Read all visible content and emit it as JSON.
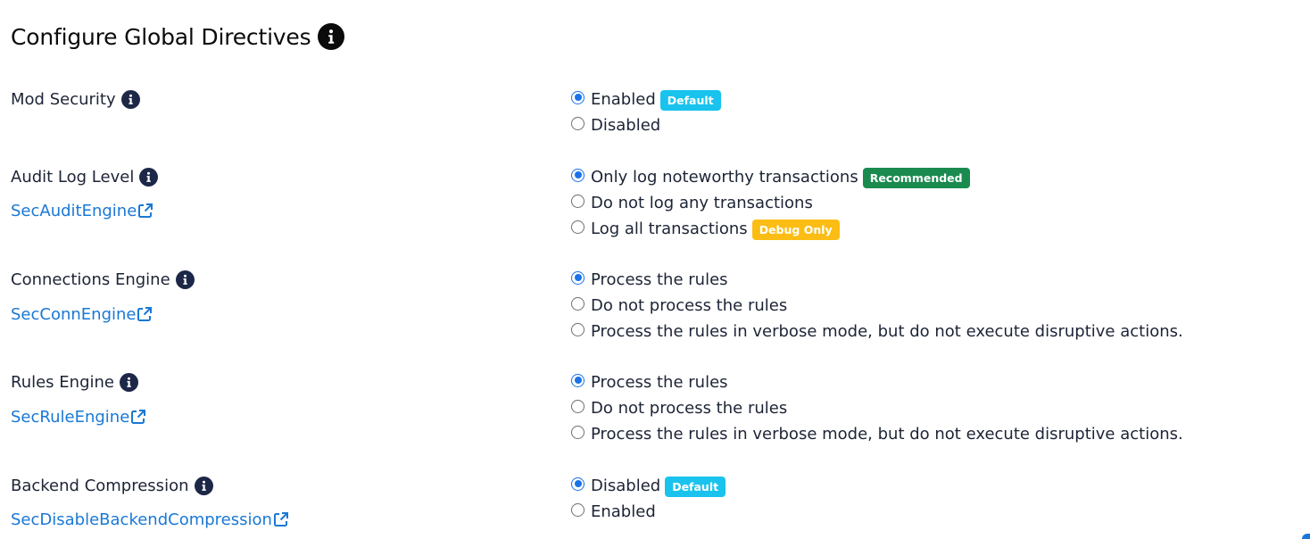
{
  "page": {
    "title": "Configure Global Directives"
  },
  "colors": {
    "default_badge": "#19c3ee",
    "recommended_badge": "#1b8a4f",
    "debug_badge": "#fbbd14",
    "link": "#1a78d4",
    "radio_selected": "#1a73e8"
  },
  "sections": [
    {
      "label": "Mod Security",
      "options": [
        {
          "label": "Enabled",
          "selected": true,
          "badge": "Default"
        },
        {
          "label": "Disabled",
          "selected": false
        }
      ]
    },
    {
      "label": "Audit Log Level",
      "link": "SecAuditEngine",
      "options": [
        {
          "label": "Only log noteworthy transactions",
          "selected": true,
          "badge": "Recommended"
        },
        {
          "label": "Do not log any transactions",
          "selected": false
        },
        {
          "label": "Log all transactions",
          "selected": false,
          "badge": "Debug Only"
        }
      ]
    },
    {
      "label": "Connections Engine",
      "link": "SecConnEngine",
      "options": [
        {
          "label": "Process the rules",
          "selected": true
        },
        {
          "label": "Do not process the rules",
          "selected": false
        },
        {
          "label": "Process the rules in verbose mode, but do not execute disruptive actions.",
          "selected": false
        }
      ]
    },
    {
      "label": "Rules Engine",
      "link": "SecRuleEngine",
      "options": [
        {
          "label": "Process the rules",
          "selected": true
        },
        {
          "label": "Do not process the rules",
          "selected": false
        },
        {
          "label": "Process the rules in verbose mode, but do not execute disruptive actions.",
          "selected": false
        }
      ]
    },
    {
      "label": "Backend Compression",
      "link": "SecDisableBackendCompression",
      "options": [
        {
          "label": "Disabled",
          "selected": true,
          "badge": "Default"
        },
        {
          "label": "Enabled",
          "selected": false
        }
      ]
    }
  ]
}
